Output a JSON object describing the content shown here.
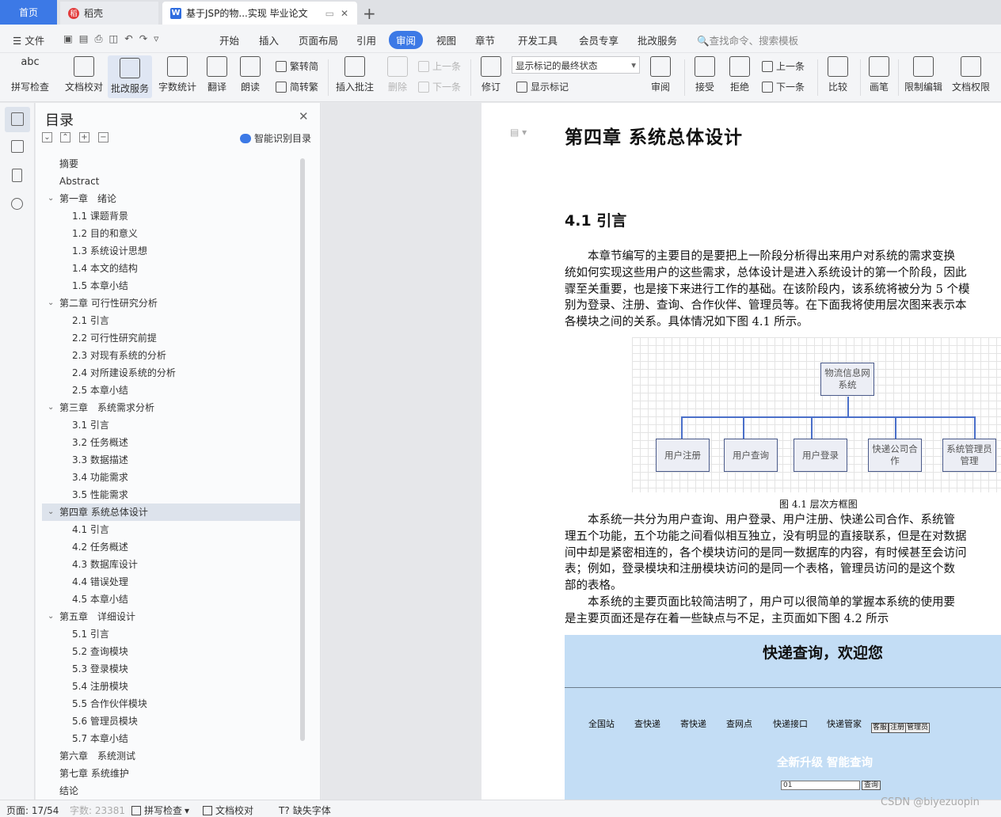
{
  "tabs": {
    "home": "首页",
    "daoke": "稻壳",
    "doc": "基于JSP的物...实现 毕业论文"
  },
  "menu": {
    "file": "文件",
    "items": [
      "开始",
      "插入",
      "页面布局",
      "引用",
      "审阅",
      "视图",
      "章节",
      "开发工具",
      "会员专享",
      "批改服务"
    ],
    "search": "查找命令、搜索模板"
  },
  "ribbon": {
    "spell": "拼写检查",
    "doc_check": "文档校对",
    "correct": "批改服务",
    "word_count": "字数统计",
    "translate": "翻译",
    "read": "朗读",
    "trad": "繁转简",
    "simp": "简转繁",
    "insert_comment": "插入批注",
    "delete": "删除",
    "prev": "上一条",
    "next": "下一条",
    "track": "修订",
    "markup_select": "显示标记的最终状态",
    "show_markup": "显示标记",
    "review": "审阅",
    "accept": "接受",
    "reject": "拒绝",
    "prev2": "上一条",
    "next2": "下一条",
    "compare": "比较",
    "pen": "画笔",
    "restrict": "限制编辑",
    "perm": "文档权限"
  },
  "toc": {
    "title": "目录",
    "smart": "智能识别目录",
    "items": [
      {
        "t": "摘要",
        "lv": 1
      },
      {
        "t": "Abstract",
        "lv": 1
      },
      {
        "t": "第一章　绪论",
        "lv": 0
      },
      {
        "t": "1.1 课题背景",
        "lv": 2
      },
      {
        "t": "1.2 目的和意义",
        "lv": 2
      },
      {
        "t": "1.3 系统设计思想",
        "lv": 2
      },
      {
        "t": "1.4 本文的结构",
        "lv": 2
      },
      {
        "t": "1.5 本章小结",
        "lv": 2
      },
      {
        "t": "第二章 可行性研究分析",
        "lv": 0
      },
      {
        "t": "2.1 引言",
        "lv": 2
      },
      {
        "t": "2.2 可行性研究前提",
        "lv": 2
      },
      {
        "t": "2.3 对现有系统的分析",
        "lv": 2
      },
      {
        "t": "2.4 对所建设系统的分析",
        "lv": 2
      },
      {
        "t": "2.5 本章小结",
        "lv": 2
      },
      {
        "t": "第三章　系统需求分析",
        "lv": 0
      },
      {
        "t": "3.1 引言",
        "lv": 2
      },
      {
        "t": "3.2 任务概述",
        "lv": 2
      },
      {
        "t": "3.3 数据描述",
        "lv": 2
      },
      {
        "t": "3.4 功能需求",
        "lv": 2
      },
      {
        "t": "3.5 性能需求",
        "lv": 2
      },
      {
        "t": "第四章  系统总体设计",
        "lv": 0,
        "sel": true
      },
      {
        "t": "4.1 引言",
        "lv": 2
      },
      {
        "t": "4.2 任务概述",
        "lv": 2
      },
      {
        "t": "4.3 数据库设计",
        "lv": 2
      },
      {
        "t": "4.4 错误处理",
        "lv": 2
      },
      {
        "t": "4.5 本章小结",
        "lv": 2
      },
      {
        "t": "第五章　详细设计",
        "lv": 0
      },
      {
        "t": "5.1 引言",
        "lv": 2
      },
      {
        "t": "5.2 查询模块",
        "lv": 2
      },
      {
        "t": "5.3 登录模块",
        "lv": 2
      },
      {
        "t": "5.4  注册模块",
        "lv": 2
      },
      {
        "t": "5.5 合作伙伴模块",
        "lv": 2
      },
      {
        "t": "5.6 管理员模块",
        "lv": 2
      },
      {
        "t": "5.7 本章小结",
        "lv": 2
      },
      {
        "t": "第六章　系统测试",
        "lv": 1
      },
      {
        "t": "第七章  系统维护",
        "lv": 1
      },
      {
        "t": "结论",
        "lv": 1
      }
    ]
  },
  "doc": {
    "h1": "第四章  系统总体设计",
    "h2": "4.1 引言",
    "p1": [
      "　　本章节编写的主要目的是要把上一阶段分析得出来用户对系统的需求变换",
      "统如何实现这些用户的这些需求，总体设计是进入系统设计的第一个阶段，因此",
      "骤至关重要，也是接下来进行工作的基础。在该阶段内，该系统将被分为 5 个模",
      "别为登录、注册、查询、合作伙伴、管理员等。在下面我将使用层次图来表示本",
      "各模块之间的关系。具体情况如下图 4.1 所示。"
    ],
    "fig": {
      "root": "物流信息网系统",
      "children": [
        "用户注册",
        "用户查询",
        "用户登录",
        "快递公司合作",
        "系统管理员管理"
      ],
      "caption": "图 4.1 层次方框图"
    },
    "p2": [
      "　　本系统一共分为用户查询、用户登录、用户注册、快递公司合作、系统管",
      "理五个功能，五个功能之间看似相互独立，没有明显的直接联系，但是在对数据",
      "间中却是紧密相连的，各个模块访问的是同一数据库的内容，有时候甚至会访问",
      "表；例如，登录模块和注册模块访问的是同一个表格，管理员访问的是这个数",
      "部的表格。",
      "　　本系统的主要页面比较简洁明了，用户可以很简单的掌握本系统的使用要",
      "是主要页面还是存在着一些缺点与不足，主页面如下图 4.2 所示"
    ],
    "shot": {
      "title": "快递查询，欢迎您",
      "nav": [
        "全国站",
        "查快递",
        "寄快递",
        "查网点",
        "快递接口",
        "快递管家"
      ],
      "buttons": [
        "客服",
        "注册",
        "管理员"
      ],
      "slogan": "全新升级 智能查询",
      "input": "01",
      "query": "查询"
    }
  },
  "status": {
    "page": "页面: 17/54",
    "words": "字数: 23381",
    "spell": "拼写检查",
    "check": "文档校对",
    "font": "缺失字体"
  },
  "watermark": "CSDN @biyezuopin"
}
